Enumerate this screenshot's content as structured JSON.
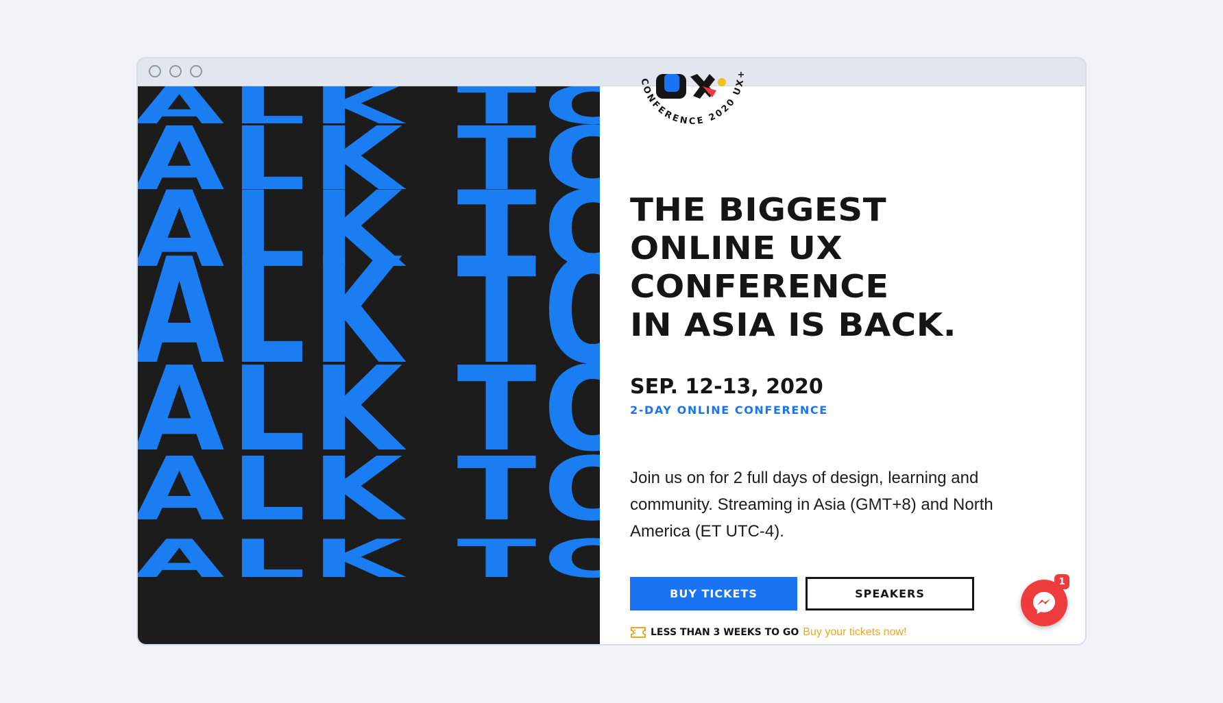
{
  "window": {
    "controls": [
      "close-dot",
      "minimize-dot",
      "maximize-dot"
    ]
  },
  "hero": {
    "pattern_text": "TALK TO",
    "background_color": "#1c1c1c",
    "text_color": "#1a7ef2"
  },
  "logo": {
    "ring_text": "CONFERENCE 2020 UX+",
    "mark": "UX+"
  },
  "headline": {
    "lines": [
      "THE BIGGEST",
      "ONLINE UX",
      "CONFERENCE",
      "IN ASIA IS BACK."
    ]
  },
  "event": {
    "date": "SEP. 12-13, 2020",
    "subtitle": "2-DAY ONLINE CONFERENCE"
  },
  "description": "Join us on for 2 full days of design, learning and community. Streaming in Asia (GMT+8) and North America (ET UTC-4).",
  "buttons": {
    "buy_tickets": "BUY TICKETS",
    "speakers": "SPEAKERS"
  },
  "promo": {
    "icon": "ticket-icon",
    "lead": "LESS THAN 3 WEEKS TO GO",
    "link": "Buy your tickets now!"
  },
  "chat": {
    "icon": "messenger-icon",
    "unread_count": "1"
  },
  "colors": {
    "accent_blue": "#1a73f0",
    "promo_yellow": "#f2a51c",
    "chat_red": "#ee3b3b",
    "text_dark": "#151515"
  }
}
